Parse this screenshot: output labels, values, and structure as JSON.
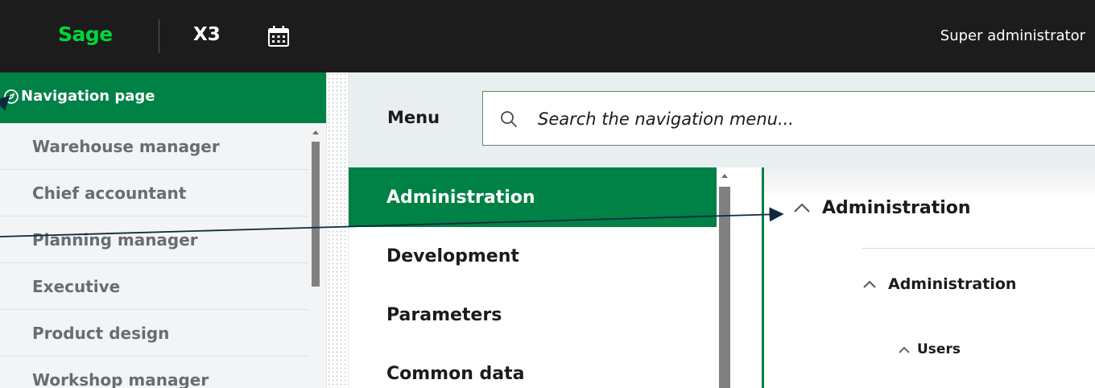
{
  "topbar": {
    "logo_text": "Sage",
    "product": "X3",
    "calendar_icon": "calendar-icon",
    "user_name": "Super administrator",
    "colors": {
      "background": "#1c1c1c",
      "logo": "#00d639"
    }
  },
  "navigation": {
    "title": "Navigation page",
    "icon": "compass-icon",
    "roles": [
      {
        "label": "Warehouse manager"
      },
      {
        "label": "Chief accountant"
      },
      {
        "label": "Planning manager"
      },
      {
        "label": "Executive"
      },
      {
        "label": "Product design"
      },
      {
        "label": "Workshop manager"
      }
    ]
  },
  "menu": {
    "label": "Menu",
    "search_placeholder": "Search the navigation menu...",
    "search_icon": "search-icon",
    "categories": [
      {
        "label": "Administration",
        "active": true
      },
      {
        "label": "Development",
        "active": false
      },
      {
        "label": "Parameters",
        "active": false
      },
      {
        "label": "Common data",
        "active": false
      }
    ]
  },
  "tree": {
    "level1": "Administration",
    "level2": "Administration",
    "level3": "Users",
    "chevron_icon": "chevron-up-icon"
  },
  "colors": {
    "accent": "#008146",
    "panel_bg": "#f2f4f5",
    "menu_bar_bg": "#e9eef0"
  }
}
